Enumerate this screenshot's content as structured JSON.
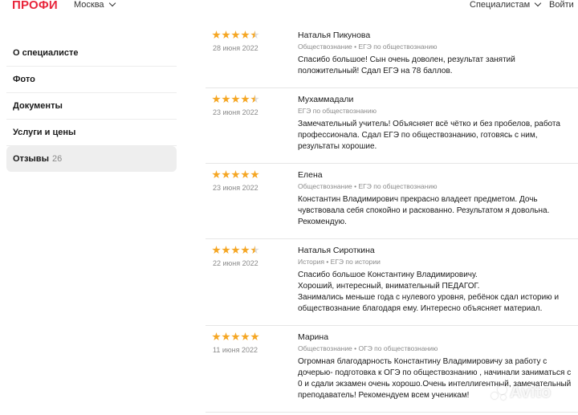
{
  "header": {
    "logo": "ПРОФИ",
    "city": "Москва",
    "specialists_link": "Специалистам",
    "login_link": "Войти"
  },
  "sidebar": {
    "items": [
      {
        "label": "О специалисте"
      },
      {
        "label": "Фото"
      },
      {
        "label": "Документы"
      },
      {
        "label": "Услуги и цены"
      },
      {
        "label": "Отзывы",
        "count": "26"
      }
    ],
    "active_index": 4
  },
  "reviews": [
    {
      "rating": 4.5,
      "date": "28 июня 2022",
      "name": "Наталья Пикунова",
      "subject": "Обществознание • ЕГЭ по обществознанию",
      "text": "Спасибо большое! Сын очень доволен, результат занятий\nположительный! Сдал ЕГЭ на 78 баллов."
    },
    {
      "rating": 4.5,
      "date": "23 июня 2022",
      "name": "Мухаммадали",
      "subject": "ЕГЭ по обществознанию",
      "text": "Замечательный учитель! Объясняет всё чётко и без пробелов, работа\nпрофессионала. Сдал ЕГЭ по обществознанию, готовясь с ним,\nрезультаты хорошие."
    },
    {
      "rating": 5,
      "date": "23 июня 2022",
      "name": "Елена",
      "subject": "Обществознание • ЕГЭ по обществознанию",
      "text": "Константин Владимирович прекрасно владеет предметом. Дочь\nчувствовала себя спокойно и раскованно. Результатом я довольна.\nРекомендую."
    },
    {
      "rating": 4.5,
      "date": "22 июня 2022",
      "name": "Наталья Сироткина",
      "subject": "История • ЕГЭ по истории",
      "text": "Спасибо большое Константину Владимировичу.\nХороший, интересный, внимательный ПЕДАГОГ.\nЗанимались меньше года с нулевого уровня, ребёнок сдал историю и\nобществознание благодаря ему. Интересно объясняет материал."
    },
    {
      "rating": 5,
      "date": "11 июня 2022",
      "name": "Марина",
      "subject": "Обществознание • ОГЭ по обществознанию",
      "text": "Огромная благодарность Константину Владимировичу за работу с\nдочерью- подготовка к ОГЭ по обществознанию , начинали заниматься с\n0 и сдали экзамен очень хорошо.Очень интеллигентный, замечательный\nпреподаватель! Рекомендуем всем ученикам!"
    }
  ],
  "watermark": "Avito",
  "colors": {
    "brand": "#e8253b",
    "star": "#f5a623"
  }
}
